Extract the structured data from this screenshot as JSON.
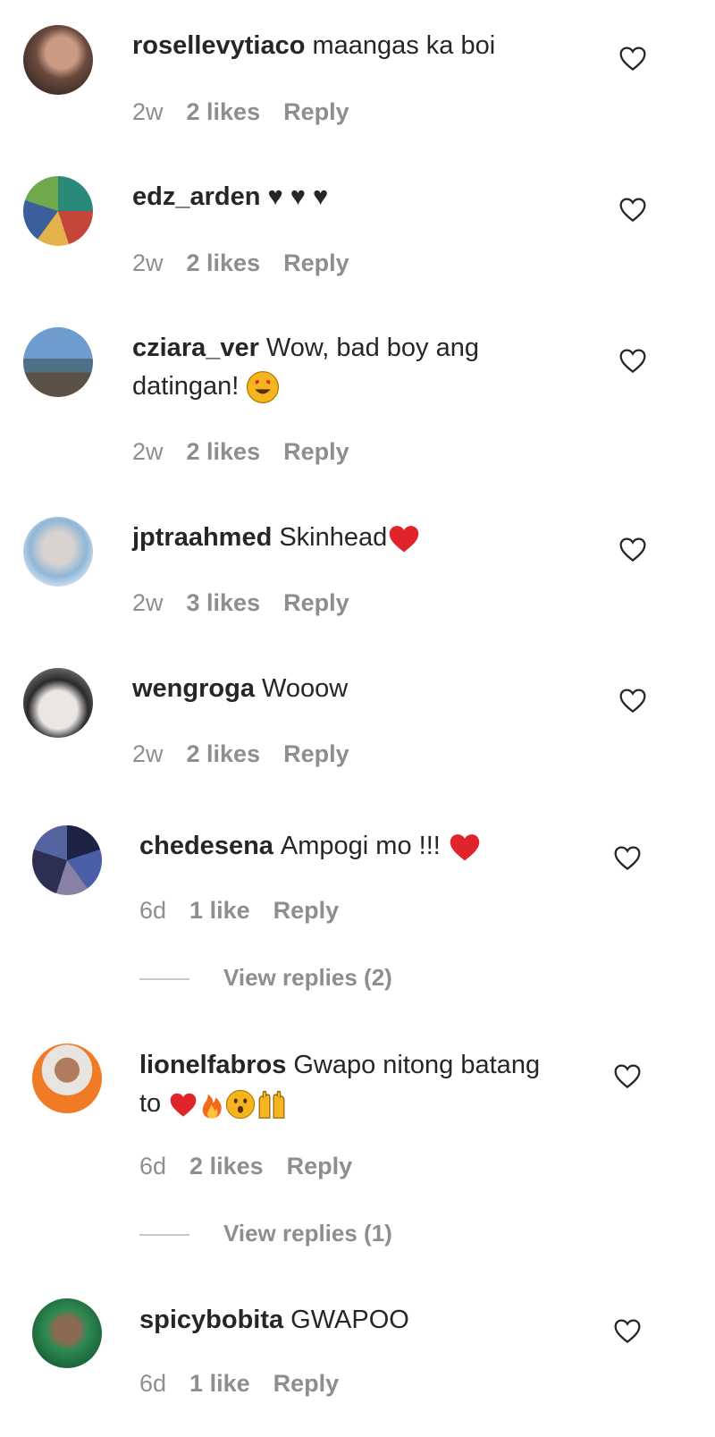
{
  "comments": [
    {
      "username": "rosellevytiaco",
      "text": "maangas ka boi",
      "time": "2w",
      "likes": "2 likes",
      "reply": "Reply"
    },
    {
      "username": "edz_arden",
      "text": "♥ ♥ ♥",
      "time": "2w",
      "likes": "2 likes",
      "reply": "Reply"
    },
    {
      "username": "cziara_ver",
      "text": "Wow, bad boy ang datingan!",
      "time": "2w",
      "likes": "2 likes",
      "reply": "Reply"
    },
    {
      "username": "jptraahmed",
      "text": "Skinhead",
      "time": "2w",
      "likes": "3 likes",
      "reply": "Reply"
    },
    {
      "username": "wengroga",
      "text": "Wooow",
      "time": "2w",
      "likes": "2 likes",
      "reply": "Reply"
    },
    {
      "username": "chedesena",
      "text": "Ampogi mo !!!",
      "time": "6d",
      "likes": "1 like",
      "reply": "Reply",
      "view_replies": "View replies (2)"
    },
    {
      "username": "lionelfabros",
      "text": "Gwapo nitong batang to",
      "time": "6d",
      "likes": "2 likes",
      "reply": "Reply",
      "view_replies": "View replies (1)"
    },
    {
      "username": "spicybobita",
      "text": "GWAPOO",
      "time": "6d",
      "likes": "1 like",
      "reply": "Reply"
    }
  ],
  "colors": {
    "text": "#262626",
    "muted": "#8e8e8e",
    "heart_red": "#e0242c"
  },
  "icons": {
    "like": "heart-outline-icon"
  }
}
